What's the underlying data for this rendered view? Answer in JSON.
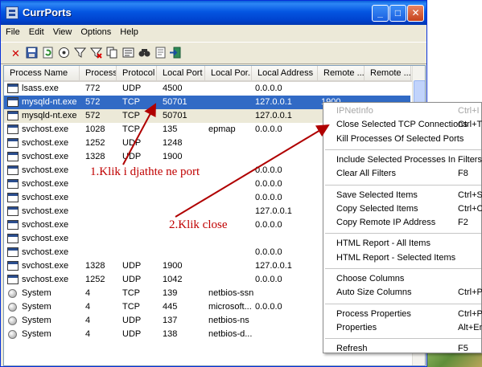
{
  "window": {
    "title": "CurrPorts",
    "buttons": {
      "minimize": "_",
      "maximize": "□",
      "close": "✕"
    }
  },
  "menu": [
    "File",
    "Edit",
    "View",
    "Options",
    "Help"
  ],
  "toolbar_icons": [
    "delete-icon",
    "save-icon",
    "refresh-icon",
    "options-icon",
    "filter-icon",
    "clear-filter-icon",
    "copy-icon",
    "properties-icon",
    "find-icon",
    "html-report-icon",
    "exit-icon"
  ],
  "columns": [
    "Process Name",
    "Process ...",
    "Protocol",
    "Local Port",
    "Local Por...",
    "Local Address",
    "Remote ...",
    "Remote ..."
  ],
  "rows": [
    {
      "name": "lsass.exe",
      "pid": "772",
      "proto": "UDP",
      "lport": "4500",
      "lportname": "",
      "laddr": "0.0.0.0",
      "rport": "",
      "icon": "window",
      "state": ""
    },
    {
      "name": "mysqld-nt.exe",
      "pid": "572",
      "proto": "TCP",
      "lport": "50701",
      "lportname": "",
      "laddr": "127.0.0.1",
      "rport": "1900",
      "icon": "window",
      "state": "sel"
    },
    {
      "name": "mysqld-nt.exe",
      "pid": "572",
      "proto": "TCP",
      "lport": "50701",
      "lportname": "",
      "laddr": "127.0.0.1",
      "rport": "",
      "icon": "window",
      "state": "hl"
    },
    {
      "name": "svchost.exe",
      "pid": "1028",
      "proto": "TCP",
      "lport": "135",
      "lportname": "epmap",
      "laddr": "0.0.0.0",
      "rport": "",
      "icon": "window",
      "state": ""
    },
    {
      "name": "svchost.exe",
      "pid": "1252",
      "proto": "UDP",
      "lport": "1248",
      "lportname": "",
      "laddr": "",
      "rport": "",
      "icon": "window",
      "state": ""
    },
    {
      "name": "svchost.exe",
      "pid": "1328",
      "proto": "UDP",
      "lport": "1900",
      "lportname": "",
      "laddr": "",
      "rport": "",
      "icon": "window",
      "state": ""
    },
    {
      "name": "svchost.exe",
      "pid": "",
      "proto": "",
      "lport": "",
      "lportname": "",
      "laddr": "0.0.0.0",
      "rport": "",
      "icon": "window",
      "state": ""
    },
    {
      "name": "svchost.exe",
      "pid": "",
      "proto": "",
      "lport": "",
      "lportname": "",
      "laddr": "0.0.0.0",
      "rport": "",
      "icon": "window",
      "state": ""
    },
    {
      "name": "svchost.exe",
      "pid": "",
      "proto": "",
      "lport": "",
      "lportname": "",
      "laddr": "0.0.0.0",
      "rport": "",
      "icon": "window",
      "state": ""
    },
    {
      "name": "svchost.exe",
      "pid": "",
      "proto": "",
      "lport": "",
      "lportname": "",
      "laddr": "127.0.0.1",
      "rport": "",
      "icon": "window",
      "state": ""
    },
    {
      "name": "svchost.exe",
      "pid": "",
      "proto": "",
      "lport": "",
      "lportname": "",
      "laddr": "0.0.0.0",
      "rport": "",
      "icon": "window",
      "state": ""
    },
    {
      "name": "svchost.exe",
      "pid": "",
      "proto": "",
      "lport": "",
      "lportname": "",
      "laddr": "",
      "rport": "",
      "icon": "window",
      "state": ""
    },
    {
      "name": "svchost.exe",
      "pid": "",
      "proto": "",
      "lport": "",
      "lportname": "",
      "laddr": "0.0.0.0",
      "rport": "",
      "icon": "window",
      "state": ""
    },
    {
      "name": "svchost.exe",
      "pid": "1328",
      "proto": "UDP",
      "lport": "1900",
      "lportname": "",
      "laddr": "127.0.0.1",
      "rport": "",
      "icon": "window",
      "state": ""
    },
    {
      "name": "svchost.exe",
      "pid": "1252",
      "proto": "UDP",
      "lport": "1042",
      "lportname": "",
      "laddr": "0.0.0.0",
      "rport": "",
      "icon": "window",
      "state": ""
    },
    {
      "name": "System",
      "pid": "4",
      "proto": "TCP",
      "lport": "139",
      "lportname": "netbios-ssn",
      "laddr": "",
      "rport": "",
      "icon": "globe",
      "state": ""
    },
    {
      "name": "System",
      "pid": "4",
      "proto": "TCP",
      "lport": "445",
      "lportname": "microsoft...",
      "laddr": "0.0.0.0",
      "rport": "",
      "icon": "globe",
      "state": ""
    },
    {
      "name": "System",
      "pid": "4",
      "proto": "UDP",
      "lport": "137",
      "lportname": "netbios-ns",
      "laddr": "",
      "rport": "",
      "icon": "globe",
      "state": ""
    },
    {
      "name": "System",
      "pid": "4",
      "proto": "UDP",
      "lport": "138",
      "lportname": "netbios-d...",
      "laddr": "",
      "rport": "",
      "icon": "globe",
      "state": ""
    }
  ],
  "context_menu": [
    {
      "label": "IPNetInfo",
      "shortcut": "Ctrl+I",
      "disabled": true
    },
    {
      "label": "Close Selected TCP Connections",
      "shortcut": "Ctrl+T"
    },
    {
      "label": "Kill Processes Of Selected Ports",
      "shortcut": ""
    },
    {
      "sep": true
    },
    {
      "label": "Include Selected Processes In Filters",
      "shortcut": ""
    },
    {
      "label": "Clear All Filters",
      "shortcut": "F8"
    },
    {
      "sep": true
    },
    {
      "label": "Save Selected Items",
      "shortcut": "Ctrl+S"
    },
    {
      "label": "Copy Selected Items",
      "shortcut": "Ctrl+C"
    },
    {
      "label": "Copy Remote IP Address",
      "shortcut": "F2"
    },
    {
      "sep": true
    },
    {
      "label": "HTML Report - All Items",
      "shortcut": ""
    },
    {
      "label": "HTML Report - Selected Items",
      "shortcut": ""
    },
    {
      "sep": true
    },
    {
      "label": "Choose Columns",
      "shortcut": ""
    },
    {
      "label": "Auto Size Columns",
      "shortcut": "Ctrl+Plu"
    },
    {
      "sep": true
    },
    {
      "label": "Process Properties",
      "shortcut": "Ctrl+P"
    },
    {
      "label": "Properties",
      "shortcut": "Alt+Ent"
    },
    {
      "sep": true
    },
    {
      "label": "Refresh",
      "shortcut": "F5"
    }
  ],
  "annotations": {
    "step1": "1.Klik i djathte ne port",
    "step2": "2.Klik close"
  },
  "colors": {
    "annotation": "#c00000",
    "selection": "#316ac5",
    "titlebar": "#0456e2"
  }
}
